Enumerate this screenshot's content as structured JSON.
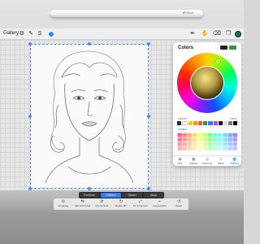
{
  "pencil": {
    "brand": "●Pencil"
  },
  "toolbar": {
    "gallery": "Gallery",
    "icons": [
      "wrench-icon",
      "magic-wand-icon",
      "selection-icon",
      "transform-arrow-icon"
    ],
    "right_icons": [
      "brush-icon",
      "smudge-icon",
      "eraser-icon",
      "layers-icon"
    ],
    "current_color": "#0a7a55"
  },
  "colors": {
    "title": "Colors",
    "history_label": "History",
    "clear_label": "Clear",
    "default_label": "Default",
    "history": [
      "#222222",
      "#ffffff",
      "#f5d400",
      "#ff9b00",
      "#ff4e4e",
      "#2d9a3a",
      "#2a7cff",
      "#b14bff",
      "#111111",
      "#e0e0e0",
      "#7a7a7a",
      "#000000"
    ],
    "tabs": [
      {
        "label": "Disc",
        "icon": "disc-icon",
        "glyph": "◉"
      },
      {
        "label": "Classic",
        "icon": "classic-icon",
        "glyph": "▣"
      },
      {
        "label": "Harmony",
        "icon": "harmony-icon",
        "glyph": "◎"
      },
      {
        "label": "Value",
        "icon": "value-icon",
        "glyph": "≡"
      },
      {
        "label": "Palettes",
        "icon": "palettes-icon",
        "glyph": "▦"
      }
    ],
    "active_tab": "Palettes"
  },
  "modes": [
    "Freeform",
    "Uniform",
    "Distort",
    "Warp"
  ],
  "active_mode": "Uniform",
  "transform": [
    {
      "label": "Snapping",
      "glyph": "⊙"
    },
    {
      "label": "Flip Horizontal",
      "glyph": "⇋"
    },
    {
      "label": "Flip Vertical",
      "glyph": "⇵"
    },
    {
      "label": "Rotate 45°",
      "glyph": "↻"
    },
    {
      "label": "Fit to Canvas",
      "glyph": "⤢"
    },
    {
      "label": "Interpolation",
      "glyph": "⌁"
    },
    {
      "label": "Reset",
      "glyph": "↺"
    }
  ]
}
